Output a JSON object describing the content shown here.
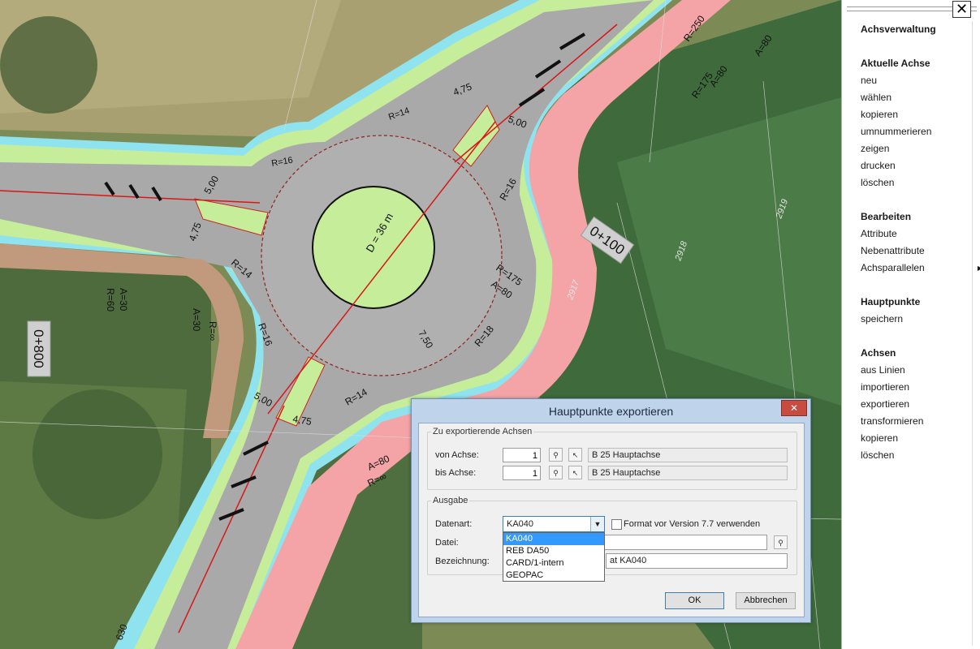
{
  "map": {
    "labels": {
      "d36": "D = 36 m",
      "station_100": "0+100",
      "station_800": "0+800",
      "station_630": "630",
      "r250": "R=250",
      "a80_top": "A=80",
      "a80_b": "A=80",
      "r175_top": "R=175",
      "r175": "R=175",
      "a80_c": "A=80",
      "a30": "A=30",
      "r60": "R=60",
      "a30_b": "A=30",
      "rinf": "R=∞",
      "a80_d": "A=80",
      "rinf_b": "R=∞",
      "r16_a": "R=16",
      "r16_b": "R=16",
      "r16_c": "R=16",
      "r14_a": "R=14",
      "r14_b": "R=14",
      "r14_c": "R=14",
      "r18": "R=18",
      "d500_a": "5,00",
      "d500_b": "5,00",
      "d500_c": "5,00",
      "d475_a": "4,75",
      "d475_b": "4,75",
      "d475_c": "4,75",
      "d750": "7,50",
      "c2917": "2917",
      "c2918": "2918",
      "c2919": "2919"
    }
  },
  "panel": {
    "close_symbol": "✕",
    "sections": {
      "achsverwaltung": "Achsverwaltung",
      "aktuelle_achse": "Aktuelle Achse",
      "aktuelle_items": [
        "neu",
        "wählen",
        "kopieren",
        "umnummerieren",
        "zeigen",
        "drucken",
        "löschen"
      ],
      "bearbeiten": "Bearbeiten",
      "bearbeiten_items": [
        "Attribute",
        "Nebenattribute",
        "Achsparallelen"
      ],
      "hauptpunkte": "Hauptpunkte",
      "hauptpunkte_items": [
        "speichern"
      ],
      "achsen": "Achsen",
      "achsen_items": [
        "aus Linien",
        "importieren",
        "exportieren",
        "transformieren",
        "kopieren",
        "löschen"
      ]
    }
  },
  "dialog": {
    "title": "Hauptpunkte exportieren",
    "close_symbol": "✕",
    "group1_legend": "Zu exportierende Achsen",
    "von_label": "von Achse:",
    "von_value": "1",
    "von_name": "B 25 Hauptachse",
    "bis_label": "bis Achse:",
    "bis_value": "1",
    "bis_name": "B 25 Hauptachse",
    "group2_legend": "Ausgabe",
    "datenart_label": "Datenart:",
    "datenart_value": "KA040",
    "format_checkbox_label": "Format vor Version 7.7 verwenden",
    "datei_label": "Datei:",
    "datei_value": "",
    "bezeichnung_label": "Bezeichnung:",
    "bezeichnung_value": "at KA040",
    "ok_label": "OK",
    "cancel_label": "Abbrechen",
    "dropdown_options": [
      "KA040",
      "REB DA50",
      "CARD/1-intern",
      "GEOPAC"
    ]
  }
}
